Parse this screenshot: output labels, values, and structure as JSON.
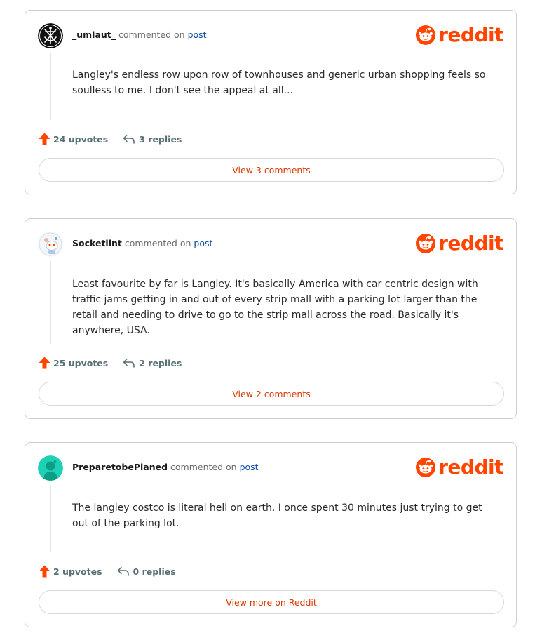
{
  "brand": {
    "wordmark": "reddit",
    "color": "#ff4500"
  },
  "comments": [
    {
      "username": "_umlaut_",
      "action": "commented on",
      "post_link": "post",
      "avatar_icon": "anchor-trident-avatar-icon",
      "text": "Langley's endless row upon row of townhouses and generic urban shopping feels so soulless to me. I don't see the appeal at all...",
      "upvotes": "24 upvotes",
      "replies": "3 replies",
      "button": "View 3 comments"
    },
    {
      "username": "Socketlint",
      "action": "commented on",
      "post_link": "post",
      "avatar_icon": "snoo-avatar-icon",
      "text": "Least favourite by far is Langley. It's basically America with car centric design with traffic jams getting in and out of every strip mall with a parking lot larger than the retail and needing to drive to go to the strip mall across the road. Basically it's anywhere, USA.",
      "upvotes": "25 upvotes",
      "replies": "2 replies",
      "button": "View 2 comments"
    },
    {
      "username": "PreparetobePlaned",
      "action": "commented on",
      "post_link": "post",
      "avatar_icon": "default-snoo-avatar-icon",
      "text": "The langley costco is literal hell on earth. I once spent 30 minutes just trying to get out of the parking lot.",
      "upvotes": "2 upvotes",
      "replies": "0 replies",
      "button": "View more on Reddit"
    }
  ]
}
